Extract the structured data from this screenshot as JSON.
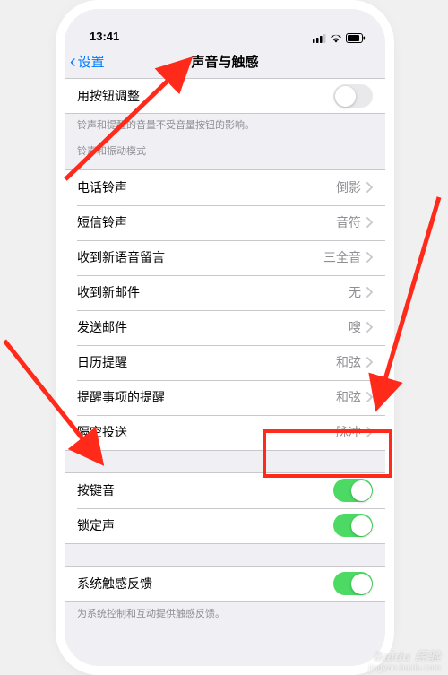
{
  "status": {
    "time": "13:41"
  },
  "nav": {
    "back": "设置",
    "title": "声音与触感"
  },
  "rows": {
    "adjust_with_buttons": "用按钮调整",
    "note_buttons": "铃声和提醒的音量不受音量按钮的影响。",
    "note_modes": "铃声和振动模式",
    "ringtone": "电话铃声",
    "ringtone_val": "倒影",
    "text_tone": "短信铃声",
    "text_tone_val": "音符",
    "voicemail": "收到新语音留言",
    "voicemail_val": "三全音",
    "mail": "收到新邮件",
    "mail_val": "无",
    "sent_mail": "发送邮件",
    "sent_mail_val": "嗖",
    "calendar": "日历提醒",
    "calendar_val": "和弦",
    "reminder": "提醒事项的提醒",
    "reminder_val": "和弦",
    "airdrop": "隔空投送",
    "airdrop_val": "脉冲",
    "keyboard": "按键音",
    "lock": "锁定声",
    "haptics": "系统触感反馈",
    "note_haptics": "为系统控制和互动提供触感反馈。"
  },
  "watermark": {
    "brand": "Baidu 经验",
    "sub": "jingyan.baidu.com"
  }
}
